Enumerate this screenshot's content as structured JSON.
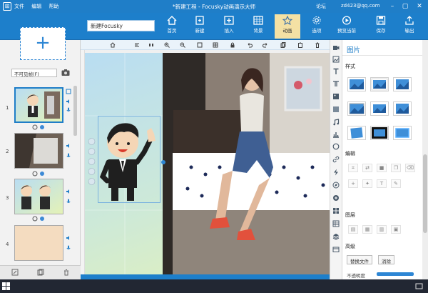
{
  "app": {
    "title": "*新建工程 - Focusky动画演示大师",
    "menu": [
      "文件",
      "编辑",
      "帮助"
    ],
    "user_label": "论坛",
    "user_email": "zd423@qq.com"
  },
  "ribbon": {
    "doc_name": "新建Focusky",
    "buttons": [
      {
        "label": "首页",
        "icon": "home-icon"
      },
      {
        "label": "新建",
        "icon": "new-icon"
      },
      {
        "label": "插入",
        "icon": "insert-icon"
      },
      {
        "label": "背景",
        "icon": "background-icon"
      },
      {
        "label": "动画",
        "icon": "animation-icon"
      },
      {
        "label": "选项",
        "icon": "options-icon"
      },
      {
        "label": "预览当前",
        "icon": "preview-icon"
      },
      {
        "label": "保存",
        "icon": "save-icon"
      },
      {
        "label": "输出",
        "icon": "export-icon"
      }
    ],
    "active": "动画"
  },
  "left_panel": {
    "visibility_select": "不可见帧(F)",
    "slides": [
      {
        "num": "1"
      },
      {
        "num": "2"
      },
      {
        "num": "3"
      },
      {
        "num": "4"
      }
    ]
  },
  "right_panel": {
    "tab_title": "图片",
    "section_style": "样式",
    "section_edit": "编辑",
    "section_layer": "图层",
    "section_advanced": "高级",
    "replace_button": "替换文件",
    "clear_button": "消除",
    "opacity_label": "不透明度"
  },
  "colors": {
    "titlebar": "#1f7ec8",
    "ribbon": "#1d7fcb",
    "active_tab": "#f4e1a4",
    "selection": "#2d86d4"
  }
}
